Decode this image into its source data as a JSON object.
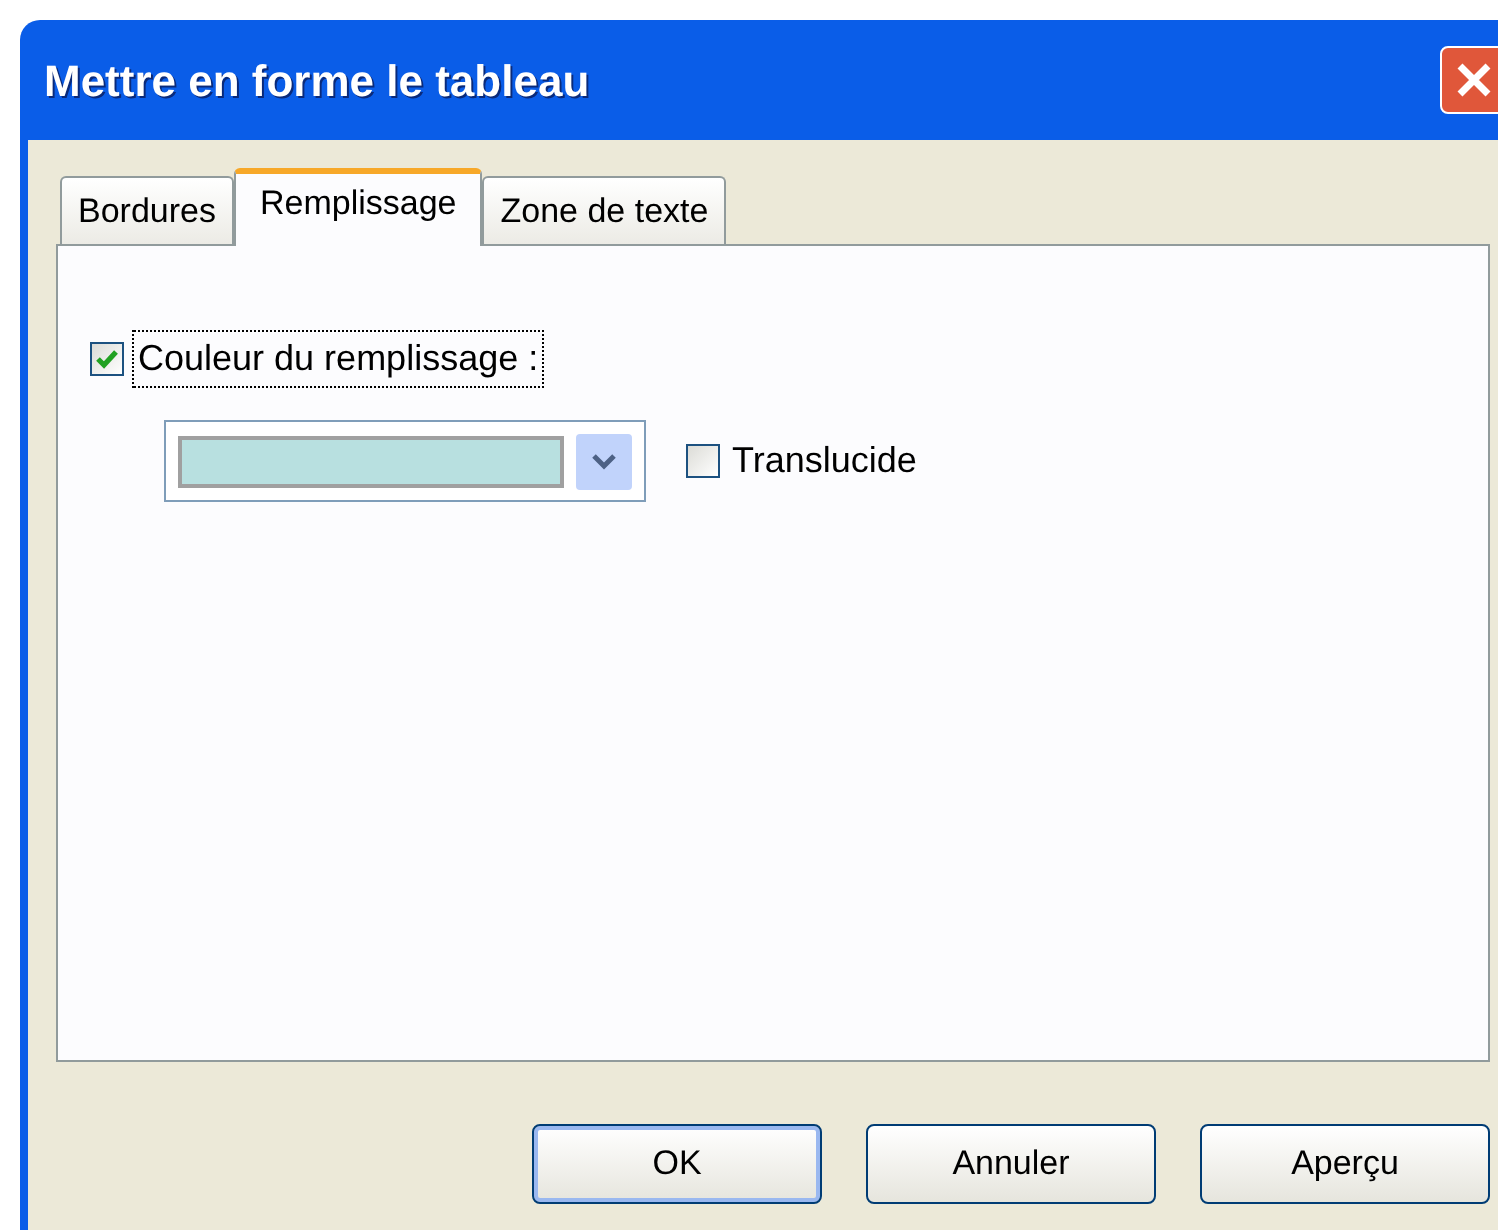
{
  "window": {
    "title": "Mettre en forme le tableau"
  },
  "tabs": [
    {
      "label": "Bordures",
      "selected": false
    },
    {
      "label": "Remplissage",
      "selected": true
    },
    {
      "label": "Zone de texte",
      "selected": false
    }
  ],
  "fill": {
    "label": "Couleur du remplissage :",
    "checked": true,
    "focused": true,
    "color": "#b8e0e0"
  },
  "translucent": {
    "label": "Translucide",
    "checked": false
  },
  "buttons": [
    {
      "label": "OK",
      "default": true
    },
    {
      "label": "Annuler",
      "default": false
    },
    {
      "label": "Aperçu",
      "default": false
    }
  ]
}
